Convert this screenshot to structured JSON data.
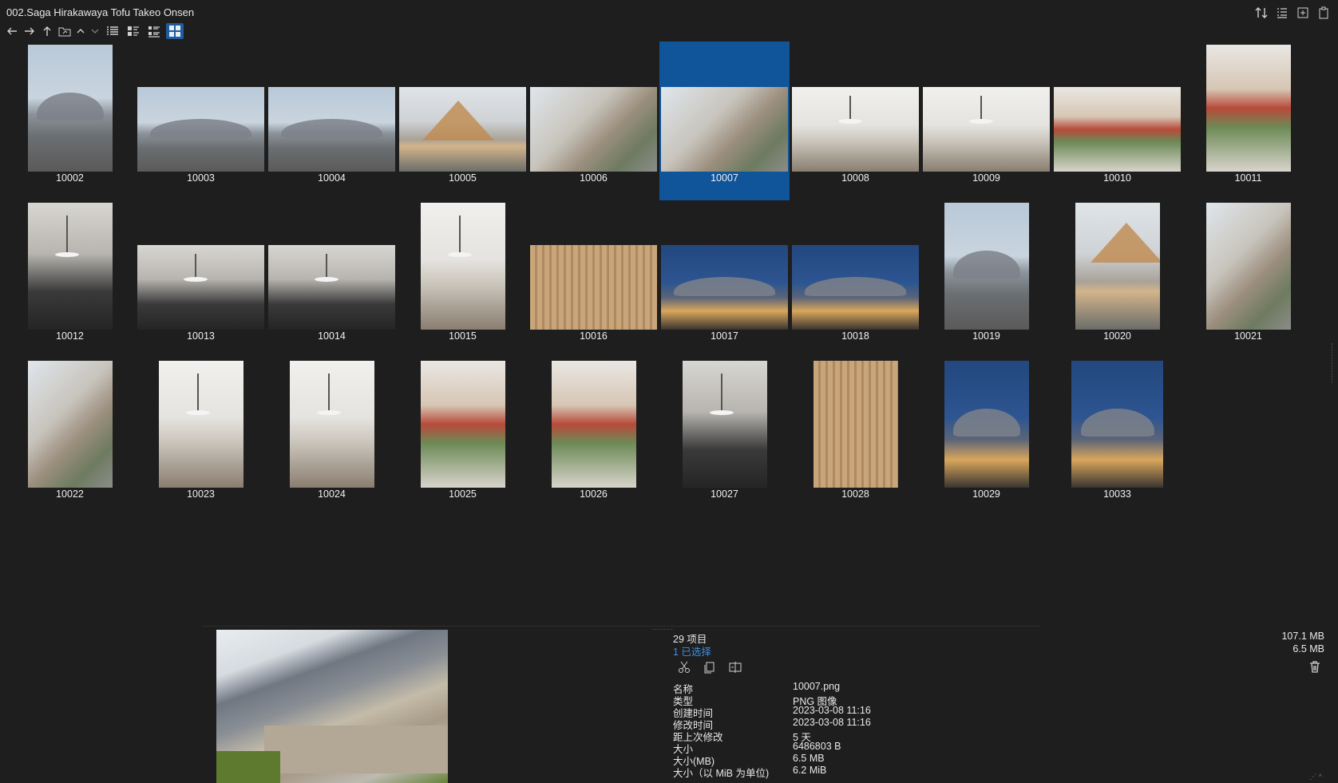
{
  "window": {
    "path_title": "002.Saga Hirakawaya Tofu Takeo Onsen"
  },
  "toolbar": {
    "back_icon": "arrow-left-icon",
    "forward_icon": "arrow-right-icon",
    "up_icon": "arrow-up-icon",
    "folder_icon": "folder-icon",
    "views": [
      "details-view",
      "medium-list-view",
      "tree-list-view",
      "thumbnail-view"
    ],
    "active_view": "thumbnail-view"
  },
  "files": [
    {
      "label": "10002",
      "theme": "t-sky",
      "orient": "portrait"
    },
    {
      "label": "10003",
      "theme": "t-sky",
      "orient": "landscape"
    },
    {
      "label": "10004",
      "theme": "t-sky",
      "orient": "landscape"
    },
    {
      "label": "10005",
      "theme": "t-house",
      "orient": "landscape"
    },
    {
      "label": "10006",
      "theme": "t-curve",
      "orient": "landscape"
    },
    {
      "label": "10007",
      "theme": "t-curve",
      "orient": "landscape",
      "selected": true
    },
    {
      "label": "10008",
      "theme": "t-interior",
      "orient": "landscape"
    },
    {
      "label": "10009",
      "theme": "t-interior",
      "orient": "landscape"
    },
    {
      "label": "10010",
      "theme": "t-red",
      "orient": "landscape"
    },
    {
      "label": "10011",
      "theme": "t-red",
      "orient": "portrait"
    },
    {
      "label": "10012",
      "theme": "t-dark-int",
      "orient": "portrait"
    },
    {
      "label": "10013",
      "theme": "t-dark-int",
      "orient": "landscape"
    },
    {
      "label": "10014",
      "theme": "t-dark-int",
      "orient": "landscape"
    },
    {
      "label": "10015",
      "theme": "t-interior",
      "orient": "portrait"
    },
    {
      "label": "10016",
      "theme": "t-wood",
      "orient": "landscape"
    },
    {
      "label": "10017",
      "theme": "t-night",
      "orient": "landscape"
    },
    {
      "label": "10018",
      "theme": "t-night",
      "orient": "landscape"
    },
    {
      "label": "10019",
      "theme": "t-sky",
      "orient": "portrait"
    },
    {
      "label": "10020",
      "theme": "t-house",
      "orient": "portrait"
    },
    {
      "label": "10021",
      "theme": "t-curve",
      "orient": "portrait"
    },
    {
      "label": "10022",
      "theme": "t-curve",
      "orient": "portrait"
    },
    {
      "label": "10023",
      "theme": "t-interior",
      "orient": "portrait"
    },
    {
      "label": "10024",
      "theme": "t-interior",
      "orient": "portrait"
    },
    {
      "label": "10025",
      "theme": "t-red",
      "orient": "portrait"
    },
    {
      "label": "10026",
      "theme": "t-red",
      "orient": "portrait"
    },
    {
      "label": "10027",
      "theme": "t-dark-int",
      "orient": "portrait"
    },
    {
      "label": "10028",
      "theme": "t-wood",
      "orient": "portrait"
    },
    {
      "label": "10029",
      "theme": "t-night",
      "orient": "portrait"
    },
    {
      "label": "10033",
      "theme": "t-night",
      "orient": "portrait-wide"
    }
  ],
  "info": {
    "item_count": "29 项目",
    "selected_count": "1 已选择",
    "total_size": "107.1 MB",
    "selected_size": "6.5 MB",
    "properties": [
      {
        "key": "名称",
        "value": "10007.png"
      },
      {
        "key": "类型",
        "value": "PNG 图像"
      },
      {
        "key": "创建时间",
        "value": "2023-03-08  11:16"
      },
      {
        "key": "修改时间",
        "value": "2023-03-08  11:16"
      },
      {
        "key": "距上次修改",
        "value": "5 天"
      },
      {
        "key": "大小",
        "value": "6486803 B"
      },
      {
        "key": "大小(MB)",
        "value": "6.5 MB"
      },
      {
        "key": "大小（以 MiB 为单位)",
        "value": "6.2 MiB"
      }
    ]
  },
  "colors": {
    "background": "#1e1e1e",
    "selection": "#10549a",
    "accent_text": "#3d8ee6"
  }
}
